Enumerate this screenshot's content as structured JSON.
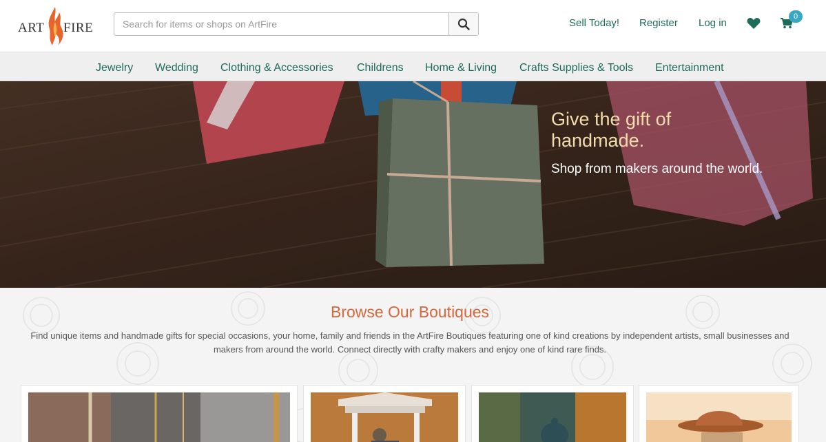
{
  "brand": {
    "logo_art": "ART",
    "logo_fire": "FIRE"
  },
  "search": {
    "placeholder": "Search for items or shops on ArtFire",
    "value": ""
  },
  "header_nav": {
    "sell": "Sell Today!",
    "register": "Register",
    "login": "Log in",
    "cart_count": "0"
  },
  "categories": [
    "Jewelry",
    "Wedding",
    "Clothing & Accessories",
    "Childrens",
    "Home & Living",
    "Crafts Supplies & Tools",
    "Entertainment"
  ],
  "hero": {
    "title": "Give the gift of handmade.",
    "subtitle": "Shop from makers around the world."
  },
  "boutiques": {
    "title": "Browse Our Boutiques",
    "description": "Find unique items and handmade gifts for special occasions, your home, family and friends in the ArtFire Boutiques featuring one of kind creations by independent artists, small businesses and makers from around the world. Connect directly with crafty makers and enjoy one of kind rare finds."
  },
  "colors": {
    "accent": "#1f6b5a",
    "heading": "#d9653b",
    "badge": "#39a7c1",
    "hero_title": "#f3dcae"
  }
}
